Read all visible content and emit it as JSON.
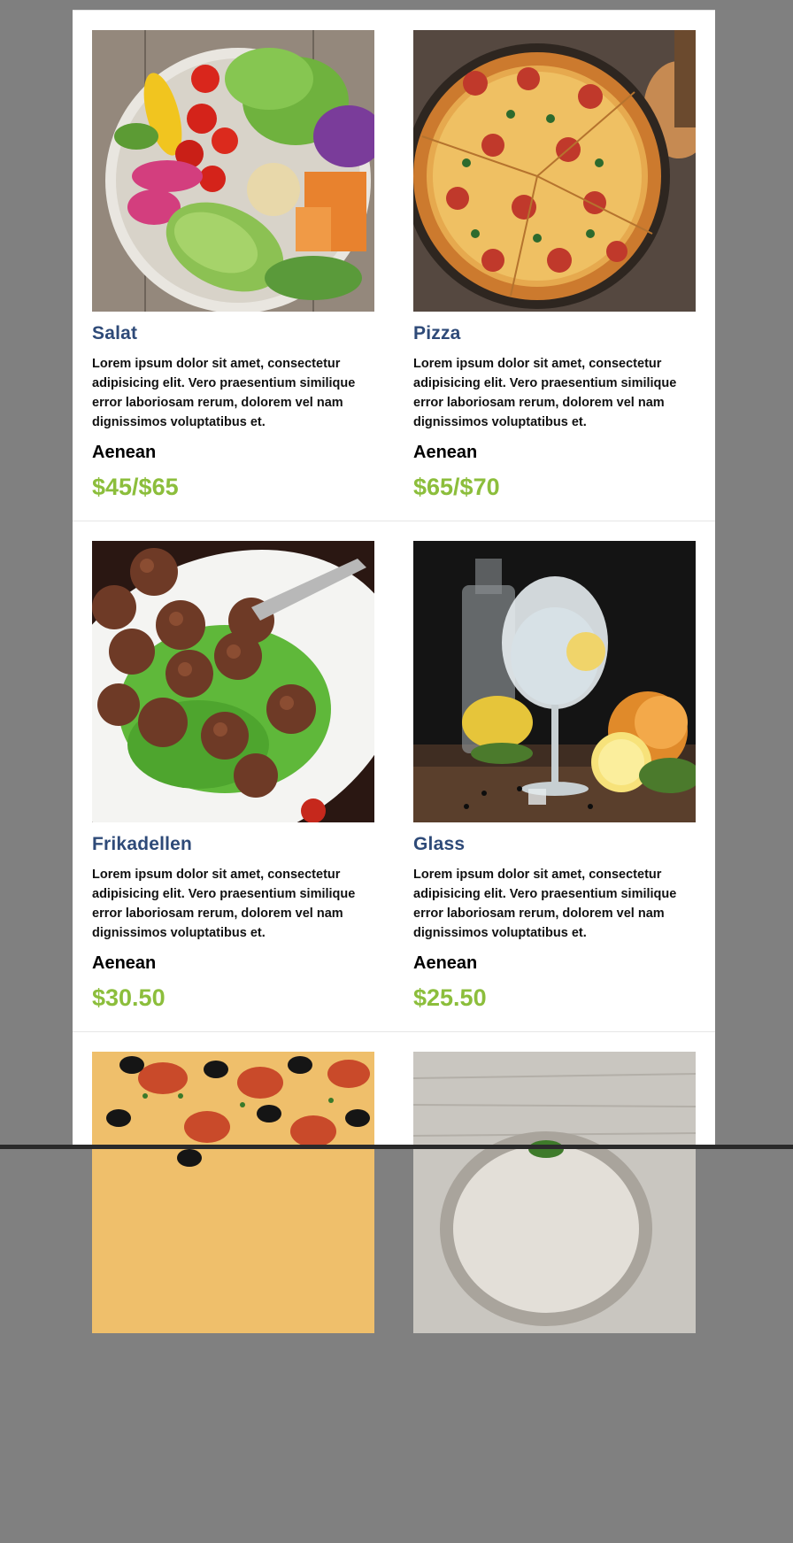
{
  "menu": {
    "items": [
      {
        "title": "Salat",
        "description": "Lorem ipsum dolor sit amet, consectetur adipisicing elit. Vero praesentium similique error laboriosam rerum, dolorem vel nam dignissimos voluptatibus et.",
        "subtitle": "Aenean",
        "price": "$45/$65",
        "image": "salad-bowl-photo"
      },
      {
        "title": "Pizza",
        "description": "Lorem ipsum dolor sit amet, consectetur adipisicing elit. Vero praesentium similique error laboriosam rerum, dolorem vel nam dignissimos voluptatibus et.",
        "subtitle": "Aenean",
        "price": "$65/$70",
        "image": "pizza-photo"
      },
      {
        "title": "Frikadellen",
        "description": "Lorem ipsum dolor sit amet, consectetur adipisicing elit. Vero praesentium similique error laboriosam rerum, dolorem vel nam dignissimos voluptatibus et.",
        "subtitle": "Aenean",
        "price": "$30.50",
        "image": "meatballs-photo"
      },
      {
        "title": "Glass",
        "description": "Lorem ipsum dolor sit amet, consectetur adipisicing elit. Vero praesentium similique error laboriosam rerum, dolorem vel nam dignissimos voluptatibus et.",
        "subtitle": "Aenean",
        "price": "$25.50",
        "image": "gin-tonic-glass-photo"
      },
      {
        "image": "pepperoni-olive-pizza-photo"
      },
      {
        "image": "bowl-on-wood-photo"
      }
    ]
  },
  "colors": {
    "title": "#2e4a78",
    "price": "#8cbe3c",
    "background": "#808080",
    "card": "#ffffff"
  }
}
